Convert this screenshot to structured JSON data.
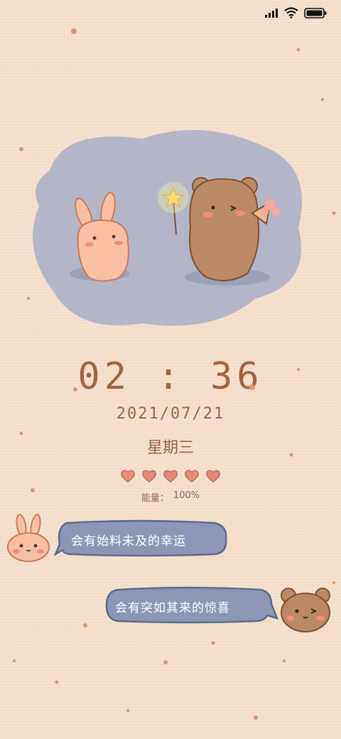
{
  "status_bar": {
    "signal_icon": "signal-icon",
    "wifi_icon": "wifi-icon",
    "battery_icon": "battery-icon"
  },
  "clock": {
    "time": "02 : 36",
    "date": "2021/07/21",
    "weekday": "星期三"
  },
  "energy": {
    "label": "能量：",
    "value": "100%",
    "hearts": 5
  },
  "messages": [
    {
      "sender": "rabbit",
      "text": "会有始料未及的幸运"
    },
    {
      "sender": "bear",
      "text": "会有突如其来的惊喜"
    }
  ],
  "colors": {
    "background": "#f5e2cf",
    "bubble": "#8d97b5",
    "bubble_border": "#5c6a8c",
    "heart": "#e58b7a",
    "accent": "#a2653d"
  }
}
